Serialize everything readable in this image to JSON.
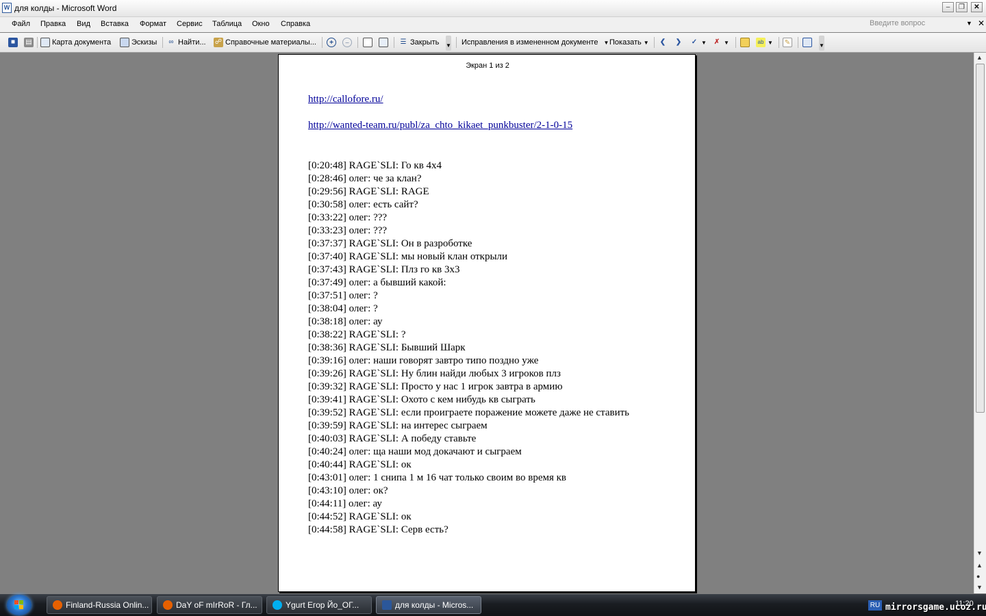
{
  "window": {
    "title": "для колды - Microsoft Word",
    "app_icon_letter": "W"
  },
  "menu": {
    "items": [
      "Файл",
      "Правка",
      "Вид",
      "Вставка",
      "Формат",
      "Сервис",
      "Таблица",
      "Окно",
      "Справка"
    ],
    "help_placeholder": "Введите вопрос"
  },
  "toolbar": {
    "document_map": "Карта документа",
    "thumbnails": "Эскизы",
    "find": "Найти...",
    "research": "Справочные материалы...",
    "close": "Закрыть",
    "track_changes_mode": "Исправления в измененном документе",
    "show": "Показать"
  },
  "document": {
    "page_header": "Экран 1 из 2",
    "links": [
      "http://callofore.ru/",
      "http://wanted-team.ru/publ/za_chto_kikaet_punkbuster/2-1-0-15"
    ],
    "chat": [
      "[0:20:48] RAGE`SLI: Го кв 4х4",
      "[0:28:46] олег: че за клан?",
      "[0:29:56] RAGE`SLI: RAGE",
      "[0:30:58] олег: есть сайт?",
      "[0:33:22] олег: ???",
      "[0:33:23] олег: ???",
      "[0:37:37] RAGE`SLI: Он в разроботке",
      "[0:37:40] RAGE`SLI: мы новый клан открыли",
      "[0:37:43] RAGE`SLI: Плз го кв 3х3",
      "[0:37:49] олег: а бывший какой:",
      "[0:37:51] олег: ?",
      "[0:38:04] олег: ?",
      "[0:38:18] олег: ау",
      "[0:38:22] RAGE`SLI: ?",
      "[0:38:36] RAGE`SLI: Бывший Шарк",
      "[0:39:16] олег: наши говорят завтро типо поздно уже",
      "[0:39:26] RAGE`SLI: Ну блин найди любых 3 игроков плз",
      "[0:39:32] RAGE`SLI: Просто у нас 1 игрок завтра в армию",
      "[0:39:41] RAGE`SLI: Охото с кем нибудь кв сыграть",
      "[0:39:52] RAGE`SLI: если проиграете поражение можете даже не ставить",
      "[0:39:59] RAGE`SLI: на интерес сыграем",
      "[0:40:03] RAGE`SLI: А победу ставьте",
      "[0:40:24] олег: ща наши мод докачают и сыграем",
      "[0:40:44] RAGE`SLI: ок",
      "[0:43:01] олег: 1 снипа 1 м 16 чат только своим во время кв",
      "[0:43:10] олег: ок?",
      "[0:44:11] олег: ау",
      "[0:44:52] RAGE`SLI: ок",
      "[0:44:58] RAGE`SLI: Серв есть?"
    ]
  },
  "taskbar": {
    "tasks": [
      {
        "label": "Finland-Russia Onlin...",
        "icon": "firefox-icon",
        "color": "#e66000"
      },
      {
        "label": "DaY oF mIrRoR - Гл...",
        "icon": "firefox-icon",
        "color": "#e66000"
      },
      {
        "label": "Ygurt Егор Йо_ОГ...",
        "icon": "skype-icon",
        "color": "#00aff0"
      },
      {
        "label": "для колды - Micros...",
        "icon": "word-icon",
        "color": "#2b579a"
      }
    ],
    "language": "RU",
    "clock": "11:20",
    "watermark": "mirrorsgame.ucoz.ru"
  }
}
